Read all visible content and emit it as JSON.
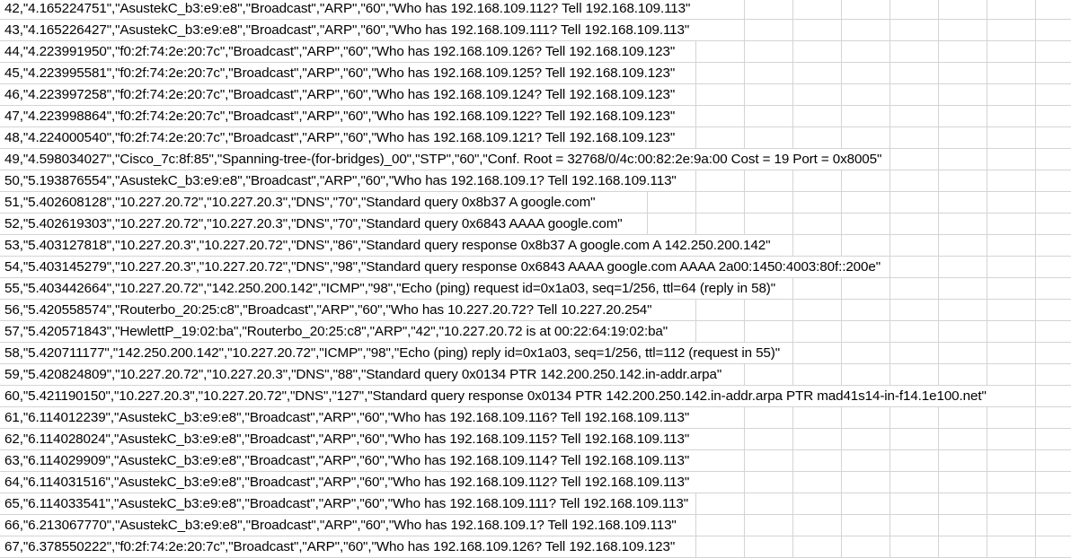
{
  "sheet": {
    "gridline_color": "#d4d4d4",
    "rows": [
      "42,\"4.165224751\",\"AsustekC_b3:e9:e8\",\"Broadcast\",\"ARP\",\"60\",\"Who has 192.168.109.112? Tell 192.168.109.113\"",
      "43,\"4.165226427\",\"AsustekC_b3:e9:e8\",\"Broadcast\",\"ARP\",\"60\",\"Who has 192.168.109.111? Tell 192.168.109.113\"",
      "44,\"4.223991950\",\"f0:2f:74:2e:20:7c\",\"Broadcast\",\"ARP\",\"60\",\"Who has 192.168.109.126? Tell 192.168.109.123\"",
      "45,\"4.223995581\",\"f0:2f:74:2e:20:7c\",\"Broadcast\",\"ARP\",\"60\",\"Who has 192.168.109.125? Tell 192.168.109.123\"",
      "46,\"4.223997258\",\"f0:2f:74:2e:20:7c\",\"Broadcast\",\"ARP\",\"60\",\"Who has 192.168.109.124? Tell 192.168.109.123\"",
      "47,\"4.223998864\",\"f0:2f:74:2e:20:7c\",\"Broadcast\",\"ARP\",\"60\",\"Who has 192.168.109.122? Tell 192.168.109.123\"",
      "48,\"4.224000540\",\"f0:2f:74:2e:20:7c\",\"Broadcast\",\"ARP\",\"60\",\"Who has 192.168.109.121? Tell 192.168.109.123\"",
      "49,\"4.598034027\",\"Cisco_7c:8f:85\",\"Spanning-tree-(for-bridges)_00\",\"STP\",\"60\",\"Conf. Root = 32768/0/4c:00:82:2e:9a:00  Cost = 19  Port = 0x8005\"",
      "50,\"5.193876554\",\"AsustekC_b3:e9:e8\",\"Broadcast\",\"ARP\",\"60\",\"Who has 192.168.109.1? Tell 192.168.109.113\"",
      "51,\"5.402608128\",\"10.227.20.72\",\"10.227.20.3\",\"DNS\",\"70\",\"Standard query 0x8b37 A google.com\"",
      "52,\"5.402619303\",\"10.227.20.72\",\"10.227.20.3\",\"DNS\",\"70\",\"Standard query 0x6843 AAAA google.com\"",
      "53,\"5.403127818\",\"10.227.20.3\",\"10.227.20.72\",\"DNS\",\"86\",\"Standard query response 0x8b37 A google.com A 142.250.200.142\"",
      "54,\"5.403145279\",\"10.227.20.3\",\"10.227.20.72\",\"DNS\",\"98\",\"Standard query response 0x6843 AAAA google.com AAAA 2a00:1450:4003:80f::200e\"",
      "55,\"5.403442664\",\"10.227.20.72\",\"142.250.200.142\",\"ICMP\",\"98\",\"Echo (ping) request  id=0x1a03, seq=1/256, ttl=64 (reply in 58)\"",
      "56,\"5.420558574\",\"Routerbo_20:25:c8\",\"Broadcast\",\"ARP\",\"60\",\"Who has 10.227.20.72? Tell 10.227.20.254\"",
      "57,\"5.420571843\",\"HewlettP_19:02:ba\",\"Routerbo_20:25:c8\",\"ARP\",\"42\",\"10.227.20.72 is at 00:22:64:19:02:ba\"",
      "58,\"5.420711177\",\"142.250.200.142\",\"10.227.20.72\",\"ICMP\",\"98\",\"Echo (ping) reply    id=0x1a03, seq=1/256, ttl=112 (request in 55)\"",
      "59,\"5.420824809\",\"10.227.20.72\",\"10.227.20.3\",\"DNS\",\"88\",\"Standard query 0x0134 PTR 142.200.250.142.in-addr.arpa\"",
      "60,\"5.421190150\",\"10.227.20.3\",\"10.227.20.72\",\"DNS\",\"127\",\"Standard query response 0x0134 PTR 142.200.250.142.in-addr.arpa PTR mad41s14-in-f14.1e100.net\"",
      "61,\"6.114012239\",\"AsustekC_b3:e9:e8\",\"Broadcast\",\"ARP\",\"60\",\"Who has 192.168.109.116? Tell 192.168.109.113\"",
      "62,\"6.114028024\",\"AsustekC_b3:e9:e8\",\"Broadcast\",\"ARP\",\"60\",\"Who has 192.168.109.115? Tell 192.168.109.113\"",
      "63,\"6.114029909\",\"AsustekC_b3:e9:e8\",\"Broadcast\",\"ARP\",\"60\",\"Who has 192.168.109.114? Tell 192.168.109.113\"",
      "64,\"6.114031516\",\"AsustekC_b3:e9:e8\",\"Broadcast\",\"ARP\",\"60\",\"Who has 192.168.109.112? Tell 192.168.109.113\"",
      "65,\"6.114033541\",\"AsustekC_b3:e9:e8\",\"Broadcast\",\"ARP\",\"60\",\"Who has 192.168.109.111? Tell 192.168.109.113\"",
      "66,\"6.213067770\",\"AsustekC_b3:e9:e8\",\"Broadcast\",\"ARP\",\"60\",\"Who has 192.168.109.1? Tell 192.168.109.113\"",
      "67,\"6.378550222\",\"f0:2f:74:2e:20:7c\",\"Broadcast\",\"ARP\",\"60\",\"Who has 192.168.109.126? Tell 192.168.109.123\""
    ]
  }
}
